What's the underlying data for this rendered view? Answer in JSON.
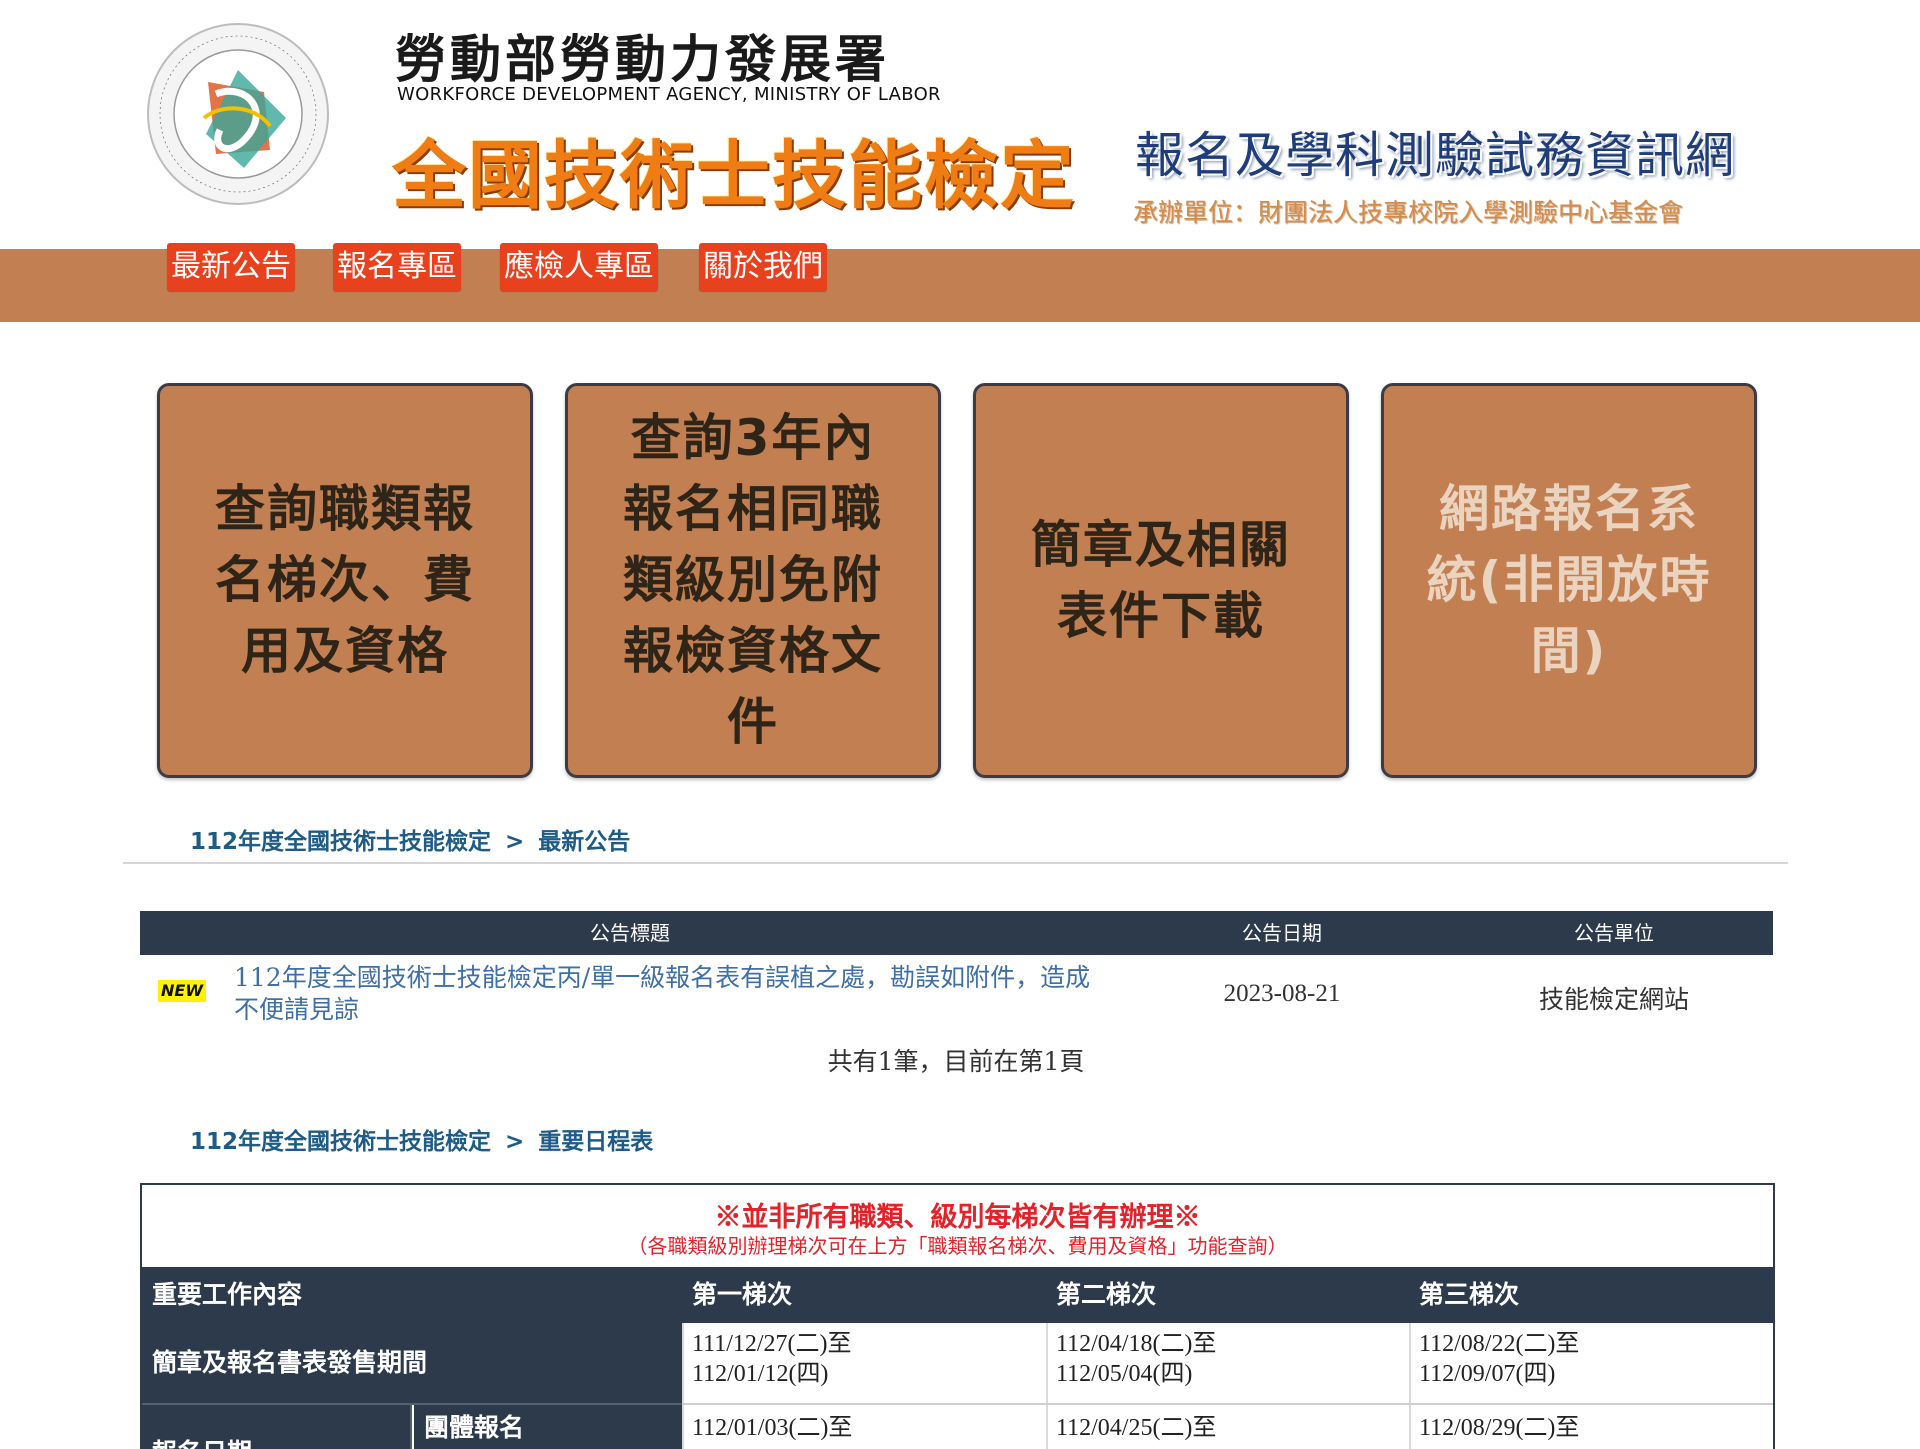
{
  "header": {
    "logo_ring_text": "勞動部勞動力發展署 WORKFORCE DEVELOPMENT AGENCY, MINISTRY OF LABOR",
    "agency_zh": "勞動部勞動力發展署",
    "agency_en": "WORKFORCE  DEVELOPMENT AGENCY, MINISTRY OF LABOR",
    "main_title": "全國技術士技能檢定",
    "sub_title": "報名及學科測驗試務資訊網",
    "organizer": "承辦單位：財團法人技專校院入學測驗中心基金會"
  },
  "nav": {
    "items": [
      "最新公告",
      "報名專區",
      "應檢人專區",
      "關於我們"
    ]
  },
  "tiles": [
    {
      "label": "查詢職類報名梯次、費用及資格",
      "enabled": true
    },
    {
      "label": "查詢3年內報名相同職類級別免附報檢資格文件",
      "enabled": true
    },
    {
      "label": "簡章及相關表件下載",
      "enabled": true
    },
    {
      "label": "網路報名系統(非開放時間)",
      "enabled": false
    }
  ],
  "breadcrumb_news": {
    "root": "112年度全國技術士技能檢定",
    "sep": ">",
    "current": "最新公告"
  },
  "announcements": {
    "columns": [
      "公告標題",
      "公告日期",
      "公告單位"
    ],
    "rows": [
      {
        "badge": "NEW",
        "title": "112年度全國技術士技能檢定丙/單一級報名表有誤植之處，勘誤如附件，造成不便請見諒",
        "date": "2023-08-21",
        "unit": "技能檢定網站"
      }
    ],
    "pager": "共有1筆，目前在第1頁"
  },
  "breadcrumb_schedule": {
    "root": "112年度全國技術士技能檢定",
    "sep": ">",
    "current": "重要日程表"
  },
  "schedule": {
    "warning": "※並非所有職類、級別每梯次皆有辦理※",
    "note": "（各職類級別辦理梯次可在上方「職類報名梯次、費用及資格」功能查詢）",
    "columns": [
      "重要工作內容",
      "第一梯次",
      "第二梯次",
      "第三梯次"
    ],
    "rows": [
      {
        "label": "簡章及報名書表發售期間",
        "cells": [
          [
            "111/12/27(二)至",
            "112/01/12(四)"
          ],
          [
            "112/04/18(二)至",
            "112/05/04(四)"
          ],
          [
            "112/08/22(二)至",
            "112/09/07(四)"
          ]
        ]
      },
      {
        "label": "報名日期",
        "sublabel": "團體報名",
        "cells": [
          [
            "112/01/03(二)至"
          ],
          [
            "112/04/25(二)至"
          ],
          [
            "112/08/29(二)至"
          ]
        ]
      }
    ]
  },
  "colors": {
    "nav_bar": "#c17f52",
    "nav_button": "#e7421d",
    "tile": "#c17f52",
    "table_header": "#2c3a4b",
    "title_orange": "#f07d14",
    "warning_red": "#e0242a",
    "link_blue": "#1e5c86"
  }
}
